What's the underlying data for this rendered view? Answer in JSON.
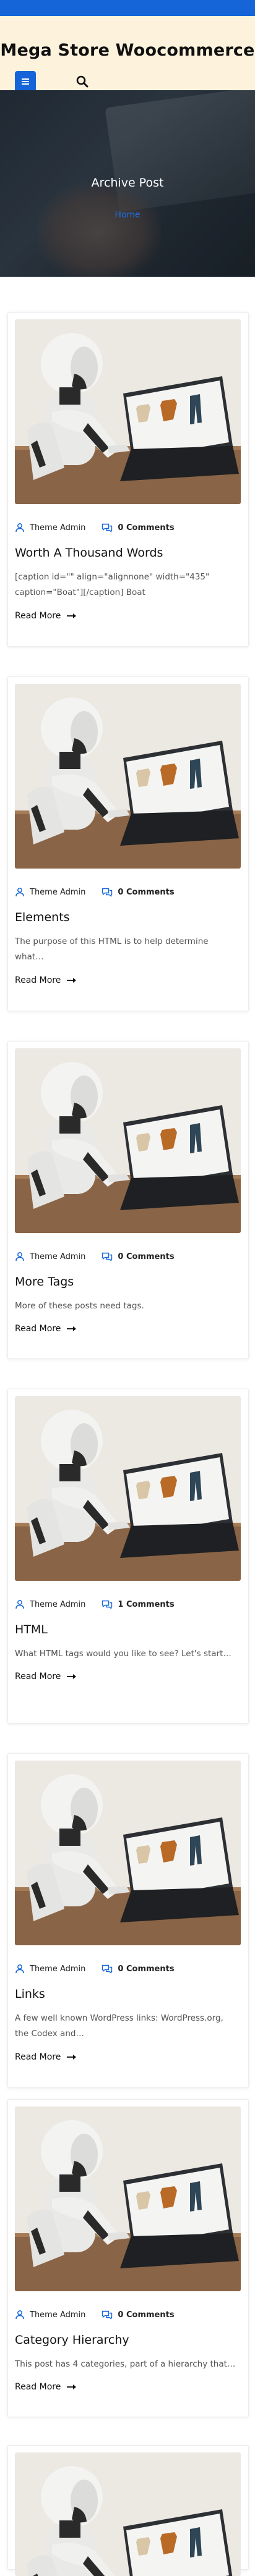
{
  "site": {
    "title": "Mega Store Woocommerce",
    "menu_icon": "menu-icon",
    "search_icon": "search-icon",
    "accent_color": "#1565d8",
    "header_bg": "#fdf3dc"
  },
  "hero": {
    "title": "Archive Post",
    "breadcrumb": "Home"
  },
  "posts": [
    {
      "author": "Theme Admin",
      "comments": "0 Comments",
      "title": "Worth A Thousand Words",
      "excerpt": "[caption id=\"\" align=\"alignnone\" width=\"435\" caption=\"Boat\"][/caption] Boat",
      "read_more": "Read More"
    },
    {
      "author": "Theme Admin",
      "comments": "0 Comments",
      "title": "Elements",
      "excerpt": "The purpose of this HTML is to help determine what…",
      "read_more": "Read More"
    },
    {
      "author": "Theme Admin",
      "comments": "0 Comments",
      "title": "More Tags",
      "excerpt": "More of these posts need tags.",
      "read_more": "Read More"
    },
    {
      "author": "Theme Admin",
      "comments": "1 Comments",
      "title": "HTML",
      "excerpt": "What HTML tags would you like to see? Let's start…",
      "read_more": "Read More"
    },
    {
      "author": "Theme Admin",
      "comments": "0 Comments",
      "title": "Links",
      "excerpt": "A few well known WordPress links: WordPress.org, the Codex and…",
      "read_more": "Read More"
    },
    {
      "author": "Theme Admin",
      "comments": "0 Comments",
      "title": "Category Hierarchy",
      "excerpt": "This post has 4 categories, part of a hierarchy that…",
      "read_more": "Read More"
    }
  ]
}
